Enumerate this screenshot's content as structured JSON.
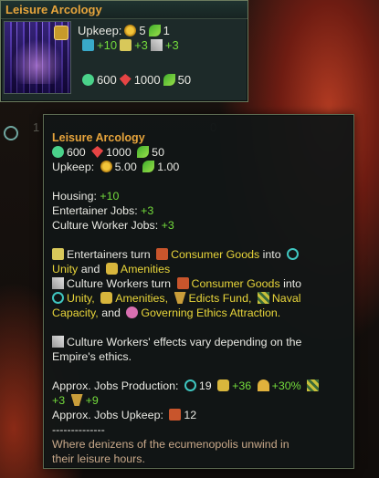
{
  "card": {
    "title": "Leisure Arcology",
    "upkeep_label": "Upkeep:",
    "upkeep_energy": "5",
    "upkeep_food": "1",
    "prod_alloys": "+10",
    "prod_entertainers": "+3",
    "prod_culture": "+3",
    "cost_jobs": "600",
    "cost_gem": "1000",
    "cost_food": "50"
  },
  "background_counts": {
    "a": "1",
    "b": "0"
  },
  "tooltip": {
    "title": "Leisure Arcology",
    "cost_jobs": "600",
    "cost_gem": "1000",
    "cost_food": "50",
    "upkeep_label": "Upkeep:",
    "upkeep_energy": "5.00",
    "upkeep_food": "1.00",
    "housing_label": "Housing:",
    "housing_value": "+10",
    "entertainer_label": "Entertainer Jobs:",
    "entertainer_value": "+3",
    "culture_label": "Culture Worker Jobs:",
    "culture_value": "+3",
    "ent_line_a": "Entertainers turn",
    "consumer_goods": "Consumer Goods",
    "into": "into",
    "unity": "Unity",
    "and": "and",
    "amenities": "Amenities",
    "cw_line_a": "Culture Workers turn",
    "into2": "into",
    "unity2": "Unity,",
    "amenities2": "Amenities,",
    "edicts_fund": "Edicts Fund,",
    "naval": "Naval",
    "capacity": "Capacity,",
    "and2": "and",
    "governing": "Governing Ethics Attraction.",
    "cw_effects_a": "Culture Workers' effects vary depending on the",
    "cw_effects_b": "Empire's ethics.",
    "approx_prod_label": "Approx. Jobs Production:",
    "prod_unity": "19",
    "prod_amenities": "+36",
    "prod_trade": "+30%",
    "prod_naval": "+3",
    "prod_edicts": "+9",
    "approx_upkeep_label": "Approx. Jobs Upkeep:",
    "upkeep_cg": "12",
    "separator": "--------------",
    "lore_a": "Where denizens of the ecumenopolis unwind in",
    "lore_b": "their leisure hours."
  },
  "colors": {
    "title": "#e6a43c",
    "positive": "#74dc3c",
    "highlight": "#e8d53a",
    "lore": "#c9a98a"
  },
  "icons": [
    "energy-icon",
    "food-icon",
    "alloys-icon",
    "entertainer-icon",
    "culture-worker-icon",
    "jobs-icon",
    "rare-gem-icon",
    "unity-icon",
    "amenities-icon",
    "consumer-goods-icon",
    "edicts-fund-icon",
    "naval-capacity-icon",
    "ethics-attraction-icon",
    "trade-icon"
  ]
}
